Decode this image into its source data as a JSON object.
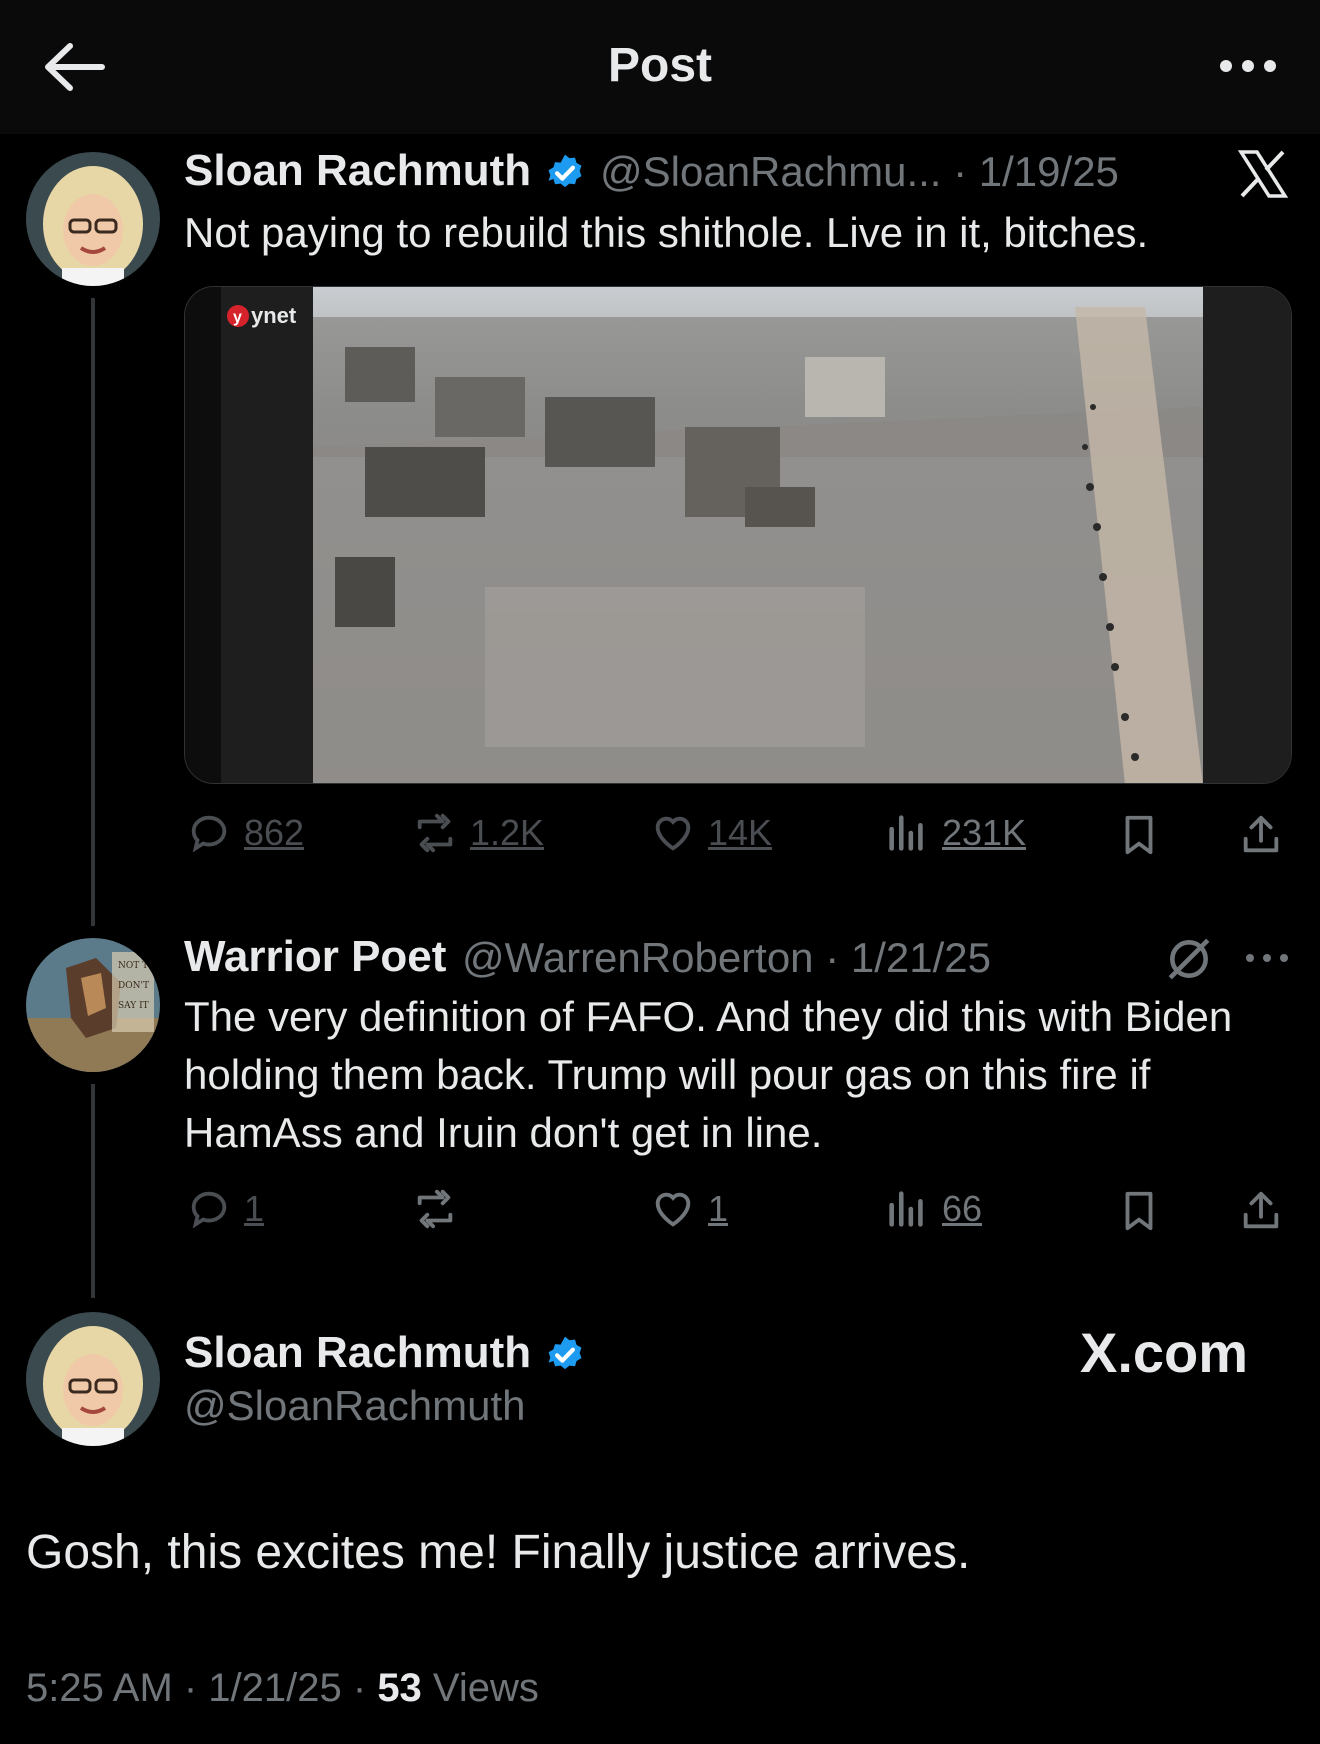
{
  "header": {
    "title": "Post"
  },
  "quoted_post": {
    "author_name": "Sloan Rachmuth",
    "handle_date": "@SloanRachmu... · 1/19/25",
    "text": "Not paying to rebuild this shithole. Live in it, bitches.",
    "media_watermark": "ynet",
    "stats": {
      "replies": "862",
      "reposts": "1.2K",
      "likes": "14K",
      "views": "231K"
    }
  },
  "reply": {
    "author_name": "Warrior Poet",
    "handle_date": "@WarrenRoberton · 1/21/25",
    "text": "The very definition of FAFO. And they did this with Biden holding them back. Trump will pour gas on this fire if HamAss and Iruin don't get in line.",
    "stats": {
      "replies": "1",
      "likes": "1",
      "views": "66"
    }
  },
  "main_post": {
    "author_name": "Sloan Rachmuth",
    "handle": "@SloanRachmuth",
    "brand": "X.com",
    "text": "Gosh, this excites me! Finally justice arrives.",
    "timestamp": "5:25 AM · 1/21/25 · ",
    "view_count": "53",
    "views_label": " Views"
  },
  "colors": {
    "background": "#000000",
    "text": "#e7e9ea",
    "muted": "#71767b",
    "verified": "#1d9bf0"
  }
}
